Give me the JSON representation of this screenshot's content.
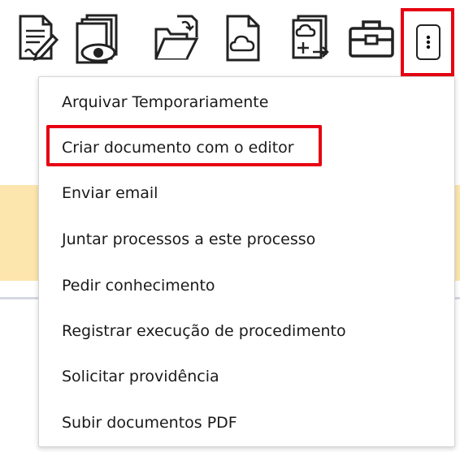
{
  "toolbar": {
    "icons": [
      "edit-document-icon",
      "view-documents-icon",
      "open-folder-icon",
      "cloud-document-icon",
      "cloud-add-document-icon",
      "toolbox-icon"
    ],
    "more_icon": "vertical-dots-icon"
  },
  "menu": {
    "items": [
      {
        "label": "Arquivar Temporariamente"
      },
      {
        "label": "Criar documento com o editor"
      },
      {
        "label": "Enviar email"
      },
      {
        "label": "Juntar processos a este processo"
      },
      {
        "label": "Pedir conhecimento"
      },
      {
        "label": "Registrar execução de procedimento"
      },
      {
        "label": "Solicitar providência"
      },
      {
        "label": "Subir documentos PDF"
      }
    ]
  },
  "colors": {
    "highlight": "#e60012",
    "background_band": "#fde6ae",
    "icon_stroke": "#222222"
  }
}
